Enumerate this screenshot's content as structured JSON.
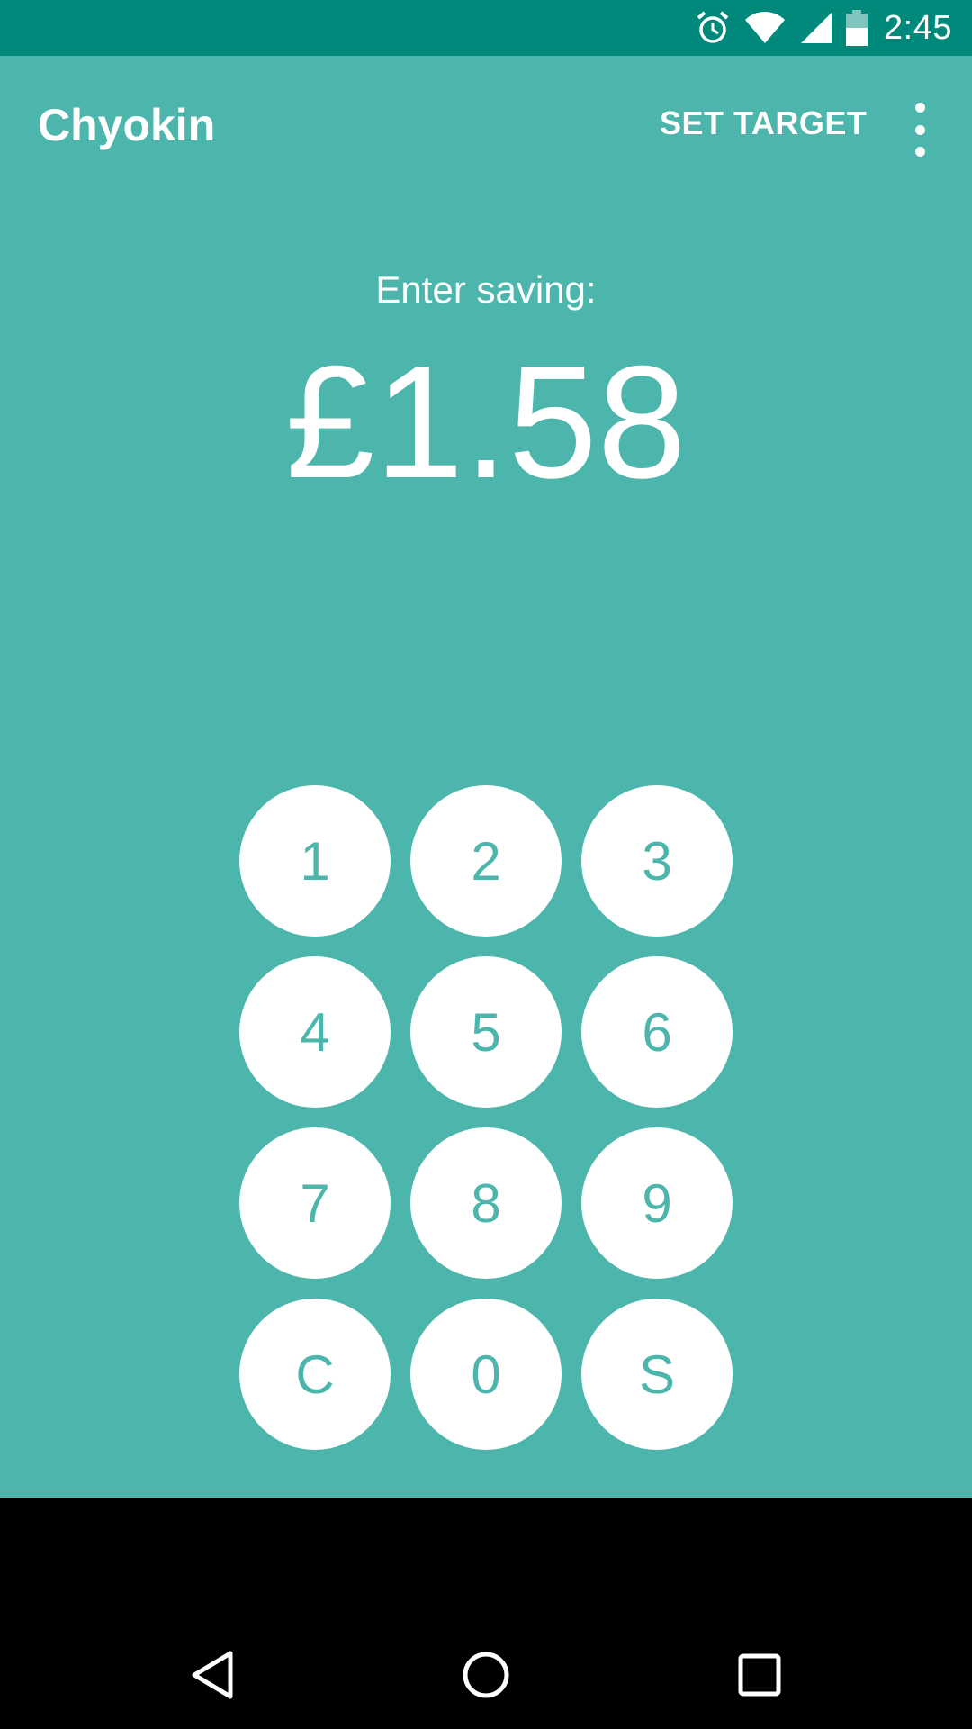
{
  "status_bar": {
    "time": "2:45",
    "icons": [
      "alarm-icon",
      "wifi-icon",
      "cell-signal-icon",
      "battery-icon"
    ],
    "background": "#00897B"
  },
  "toolbar": {
    "title": "Chyokin",
    "set_target_label": "SET TARGET",
    "overflow_icon": "more-vert-icon"
  },
  "main": {
    "prompt": "Enter saving:",
    "amount": "£1.58",
    "background": "#4DB6AC"
  },
  "keypad": {
    "keys": [
      "1",
      "2",
      "3",
      "4",
      "5",
      "6",
      "7",
      "8",
      "9",
      "C",
      "0",
      "S"
    ]
  },
  "nav_bar": {
    "icons": [
      "back-icon",
      "home-icon",
      "recents-icon"
    ]
  }
}
